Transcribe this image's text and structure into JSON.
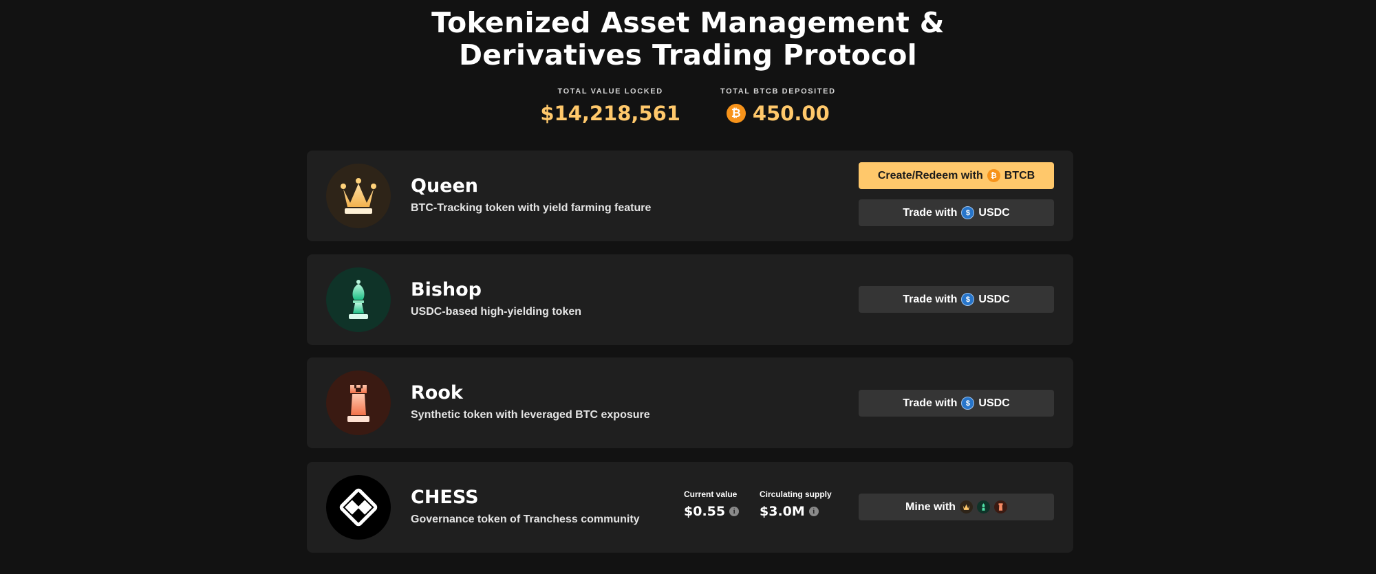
{
  "header": {
    "title_line1": "Tokenized Asset Management &",
    "title_line2": "Derivatives Trading Protocol"
  },
  "stats": {
    "tvl_label": "TOTAL VALUE LOCKED",
    "tvl_value": "$14,218,561",
    "btcb_label": "TOTAL BTCB DEPOSITED",
    "btcb_value": "450.00",
    "btcb_icon": "bitcoin-coin-icon"
  },
  "tokens": [
    {
      "name": "Queen",
      "description": "BTC-Tracking token with yield farming feature",
      "icon": "queen-crown-icon",
      "buttons": {
        "create_prefix": "Create/Redeem with",
        "create_suffix": "BTCB",
        "trade_prefix": "Trade with",
        "trade_suffix": "USDC"
      }
    },
    {
      "name": "Bishop",
      "description": "USDC-based high-yielding token",
      "icon": "bishop-chess-icon",
      "buttons": {
        "trade_prefix": "Trade with",
        "trade_suffix": "USDC"
      }
    },
    {
      "name": "Rook",
      "description": "Synthetic token with leveraged BTC exposure",
      "icon": "rook-chess-icon",
      "buttons": {
        "trade_prefix": "Trade with",
        "trade_suffix": "USDC"
      }
    },
    {
      "name": "CHESS",
      "description": "Governance token of Tranchess community",
      "icon": "chess-logo-icon",
      "metrics": {
        "current_value_label": "Current value",
        "current_value": "$0.55",
        "supply_label": "Circulating supply",
        "supply_value": "$3.0M"
      },
      "buttons": {
        "mine_prefix": "Mine with"
      }
    }
  ],
  "colors": {
    "background": "#121212",
    "card": "#1f1f1f",
    "accent": "#ffc86b",
    "button_dark": "#353535",
    "usdc": "#2775ca",
    "btc": "#f7931a"
  }
}
